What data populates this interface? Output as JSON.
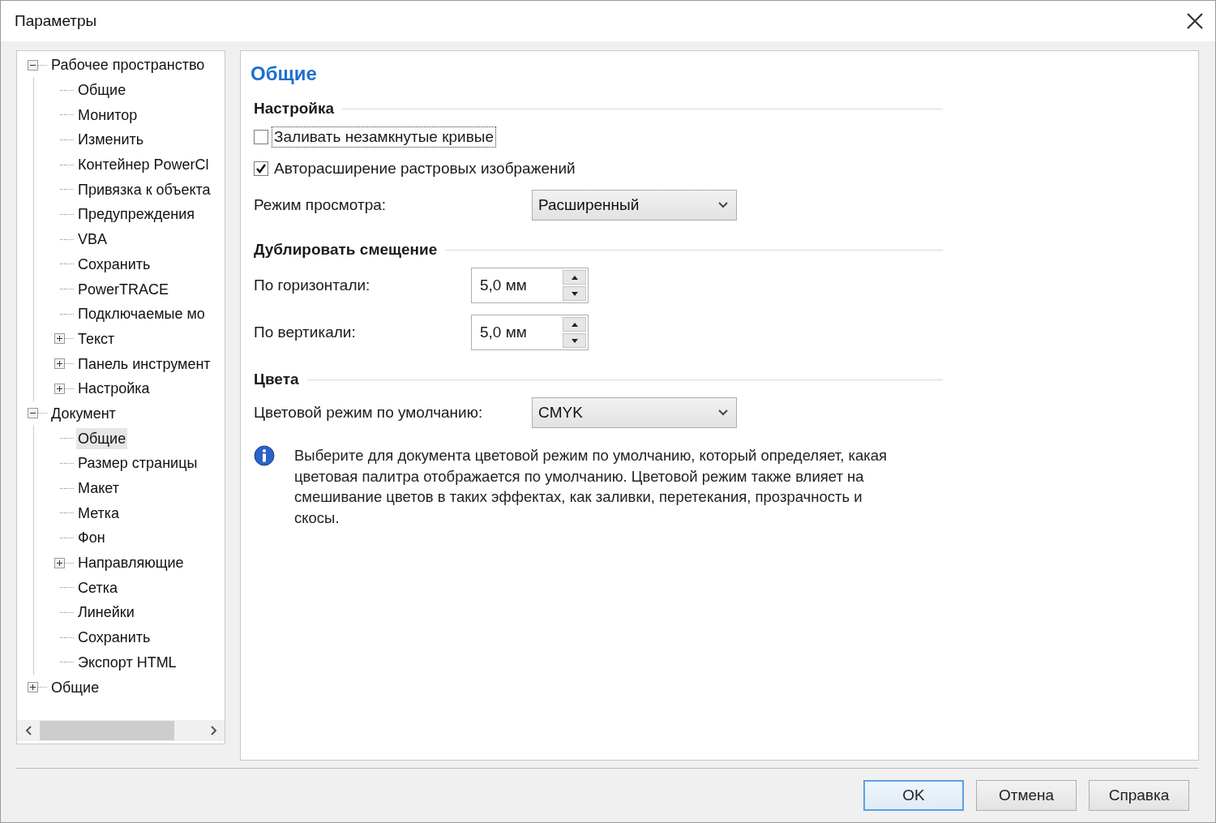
{
  "window": {
    "title": "Параметры"
  },
  "tree": {
    "items": [
      {
        "label": "Рабочее пространство",
        "selected": false,
        "expanded": true,
        "children": [
          {
            "label": "Общие",
            "selected": false
          },
          {
            "label": "Монитор",
            "selected": false
          },
          {
            "label": "Изменить",
            "selected": false
          },
          {
            "label": "Контейнер PowerCl",
            "selected": false
          },
          {
            "label": "Привязка к объекта",
            "selected": false
          },
          {
            "label": "Предупреждения",
            "selected": false
          },
          {
            "label": "VBA",
            "selected": false
          },
          {
            "label": "Сохранить",
            "selected": false
          },
          {
            "label": "PowerTRACE",
            "selected": false
          },
          {
            "label": "Подключаемые мо",
            "selected": false
          },
          {
            "label": "Текст",
            "selected": false,
            "expanded": false
          },
          {
            "label": "Панель инструмент",
            "selected": false,
            "expanded": false
          },
          {
            "label": "Настройка",
            "selected": false,
            "expanded": false
          }
        ]
      },
      {
        "label": "Документ",
        "selected": false,
        "expanded": true,
        "children": [
          {
            "label": "Общие",
            "selected": true
          },
          {
            "label": "Размер страницы",
            "selected": false
          },
          {
            "label": "Макет",
            "selected": false
          },
          {
            "label": "Метка",
            "selected": false
          },
          {
            "label": "Фон",
            "selected": false
          },
          {
            "label": "Направляющие",
            "selected": false,
            "expanded": false
          },
          {
            "label": "Сетка",
            "selected": false
          },
          {
            "label": "Линейки",
            "selected": false
          },
          {
            "label": "Сохранить",
            "selected": false
          },
          {
            "label": "Экспорт HTML",
            "selected": false
          }
        ]
      },
      {
        "label": "Общие",
        "selected": false,
        "expanded": false
      }
    ]
  },
  "page": {
    "title": "Общие",
    "sections": [
      {
        "heading": "Настройка",
        "rows": [
          {
            "kind": "checkbox",
            "label": "Заливать незамкнутые кривые",
            "checked": false,
            "focused": true
          },
          {
            "kind": "checkbox",
            "label": "Авторасширение растровых изображений",
            "checked": true,
            "focused": false
          },
          {
            "kind": "select",
            "label": "Режим просмотра:",
            "value": "Расширенный"
          }
        ]
      },
      {
        "heading": "Дублировать смещение",
        "rows": [
          {
            "kind": "spinner",
            "label": "По горизонтали:",
            "value": "5,0 мм"
          },
          {
            "kind": "spinner",
            "label": "По вертикали:",
            "value": "5,0 мм"
          }
        ]
      },
      {
        "heading": "Цвета",
        "rows": [
          {
            "kind": "select",
            "label": "Цветовой режим по умолчанию:",
            "value": "CMYK"
          },
          {
            "kind": "info",
            "text": "Выберите для документа цветовой режим по умолчанию, который определяет, какая цветовая палитра отображается по умолчанию. Цветовой режим также влияет на смешивание цветов в таких эффектах, как заливки, перетекания, прозрачность и скосы."
          }
        ]
      }
    ]
  },
  "buttons": [
    {
      "label": "OK",
      "default": true
    },
    {
      "label": "Отмена",
      "default": false
    },
    {
      "label": "Справка",
      "default": false
    }
  ]
}
